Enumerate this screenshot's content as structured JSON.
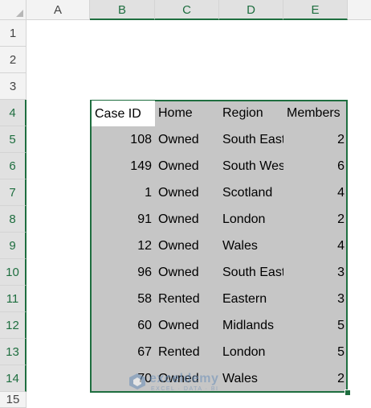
{
  "columns": [
    "A",
    "B",
    "C",
    "D",
    "E"
  ],
  "rows": [
    "1",
    "2",
    "3",
    "4",
    "5",
    "6",
    "7",
    "8",
    "9",
    "10",
    "11",
    "12",
    "13",
    "14",
    "15"
  ],
  "table": {
    "headers": [
      "Case ID",
      "Home",
      "Region",
      "Members"
    ],
    "records": [
      [
        "108",
        "Owned",
        "South East",
        "2"
      ],
      [
        "149",
        "Owned",
        "South Wes",
        "6"
      ],
      [
        "1",
        "Owned",
        "Scotland",
        "4"
      ],
      [
        "91",
        "Owned",
        "London",
        "2"
      ],
      [
        "12",
        "Owned",
        "Wales",
        "4"
      ],
      [
        "96",
        "Owned",
        "South East",
        "3"
      ],
      [
        "58",
        "Rented",
        "Eastern",
        "3"
      ],
      [
        "60",
        "Owned",
        "Midlands",
        "5"
      ],
      [
        "67",
        "Rented",
        "London",
        "5"
      ],
      [
        "70",
        "Owned",
        "Wales",
        "2"
      ]
    ]
  },
  "watermark": {
    "brand": "exceldemy",
    "tagline": "EXCEL · DATA · BI"
  },
  "colors": {
    "selection_border": "#1e6e3f",
    "selection_fill": "#c6c6c6"
  }
}
